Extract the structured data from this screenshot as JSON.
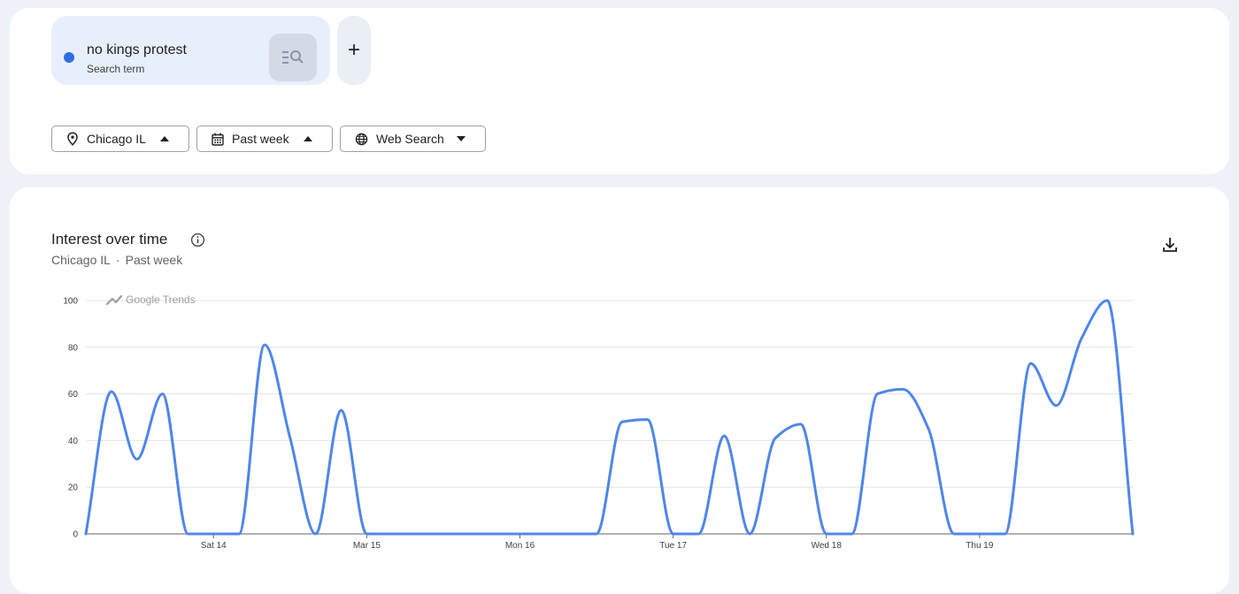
{
  "search_term": {
    "name": "no kings protest",
    "type": "Search term",
    "color": "#2f6de6"
  },
  "add_button": {
    "label": "+"
  },
  "filters": {
    "location": {
      "icon": "location-pin-icon",
      "label": "Chicago IL"
    },
    "time": {
      "icon": "calendar-icon",
      "label": "Past week"
    },
    "search_type": {
      "icon": "globe-icon",
      "label": "Web Search"
    }
  },
  "chart_section": {
    "title": "Interest over time",
    "subtitle_location": "Chicago IL",
    "subtitle_separator": "·",
    "subtitle_period": "Past week",
    "watermark": "Google Trends"
  },
  "chart_data": {
    "type": "line",
    "title": "Interest over time",
    "xlabel": "",
    "ylabel": "",
    "ylim": [
      0,
      100
    ],
    "yticks": [
      0,
      20,
      40,
      60,
      80,
      100
    ],
    "grid": true,
    "line_color": "#4f86e8",
    "x_tick_labels": [
      {
        "label": "Sat 14",
        "x": 10.0
      },
      {
        "label": "Mar 15",
        "x": 22.0
      },
      {
        "label": "Mon 16",
        "x": 34.0
      },
      {
        "label": "Tue 17",
        "x": 46.0
      },
      {
        "label": "Wed 18",
        "x": 58.0
      },
      {
        "label": "Thu 19",
        "x": 70.0
      }
    ],
    "series": [
      {
        "points": [
          [
            0,
            0
          ],
          [
            2,
            61
          ],
          [
            4,
            32
          ],
          [
            6,
            60
          ],
          [
            8,
            0
          ],
          [
            10,
            0
          ],
          [
            12,
            0
          ],
          [
            14,
            81
          ],
          [
            16,
            41
          ],
          [
            18,
            0
          ],
          [
            20,
            53
          ],
          [
            22,
            0
          ],
          [
            24,
            0
          ],
          [
            26,
            0
          ],
          [
            28,
            0
          ],
          [
            30,
            0
          ],
          [
            32,
            0
          ],
          [
            34,
            0
          ],
          [
            36,
            0
          ],
          [
            38,
            0
          ],
          [
            40,
            0
          ],
          [
            42,
            48
          ],
          [
            44,
            49
          ],
          [
            46,
            0
          ],
          [
            48,
            0
          ],
          [
            50,
            42
          ],
          [
            52,
            0
          ],
          [
            54,
            41
          ],
          [
            56,
            47
          ],
          [
            58,
            0
          ],
          [
            60,
            0
          ],
          [
            62,
            60
          ],
          [
            64,
            62
          ],
          [
            66,
            45
          ],
          [
            68,
            0
          ],
          [
            70,
            0
          ],
          [
            72,
            0
          ],
          [
            74,
            73
          ],
          [
            76,
            55
          ],
          [
            78,
            84
          ],
          [
            80,
            100
          ],
          [
            82,
            0
          ]
        ]
      }
    ]
  }
}
